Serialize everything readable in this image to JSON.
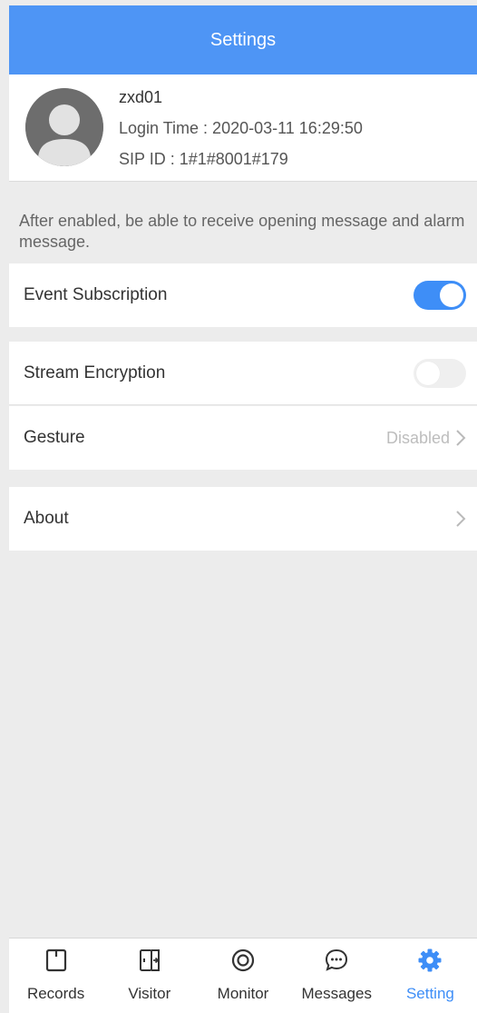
{
  "header": {
    "title": "Settings"
  },
  "profile": {
    "name": "zxd01",
    "login_time": "Login Time : 2020-03-11 16:29:50",
    "sip_id": "SIP ID : 1#1#8001#179"
  },
  "hint": "After enabled, be able to receive opening message and alarm message.",
  "settings": {
    "event_subscription": {
      "label": "Event Subscription",
      "enabled": true
    },
    "stream_encryption": {
      "label": "Stream Encryption",
      "enabled": false
    },
    "gesture": {
      "label": "Gesture",
      "value": "Disabled"
    },
    "about": {
      "label": "About"
    }
  },
  "colors": {
    "accent": "#3e8ef7",
    "header_bg": "#4e95f5",
    "page_bg": "#ececec"
  },
  "bottom_nav": {
    "items": [
      {
        "label": "Records",
        "icon": "records-icon",
        "active": false
      },
      {
        "label": "Visitor",
        "icon": "visitor-door-icon",
        "active": false
      },
      {
        "label": "Monitor",
        "icon": "monitor-camera-icon",
        "active": false
      },
      {
        "label": "Messages",
        "icon": "messages-chat-icon",
        "active": false
      },
      {
        "label": "Setting",
        "icon": "gear-icon",
        "active": true
      }
    ]
  }
}
